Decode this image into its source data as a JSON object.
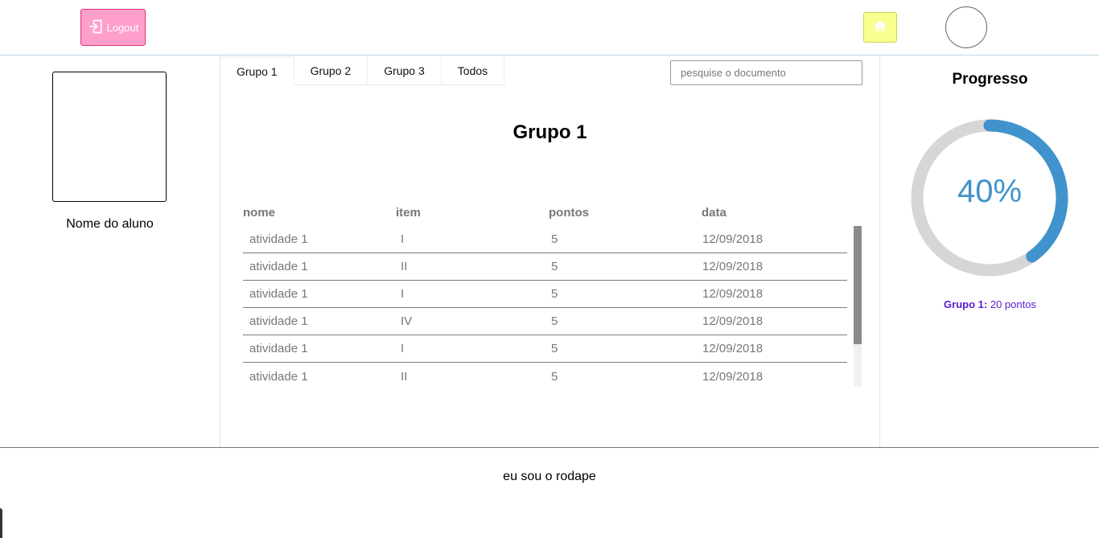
{
  "header": {
    "logout_label": "Logout"
  },
  "student": {
    "name": "Nome do aluno"
  },
  "tabs": [
    {
      "label": "Grupo 1",
      "active": true
    },
    {
      "label": "Grupo 2",
      "active": false
    },
    {
      "label": "Grupo 3",
      "active": false
    },
    {
      "label": "Todos",
      "active": false
    }
  ],
  "search": {
    "placeholder": "pesquise o documento",
    "value": ""
  },
  "main": {
    "title": "Grupo 1"
  },
  "table": {
    "headers": [
      "nome",
      "item",
      "pontos",
      "data"
    ],
    "rows": [
      [
        "atividade 1",
        "I",
        "5",
        "12/09/2018"
      ],
      [
        "atividade 1",
        "II",
        "5",
        "12/09/2018"
      ],
      [
        "atividade 1",
        "I",
        "5",
        "12/09/2018"
      ],
      [
        "atividade 1",
        "IV",
        "5",
        "12/09/2018"
      ],
      [
        "atividade 1",
        "I",
        "5",
        "12/09/2018"
      ],
      [
        "atividade 1",
        "II",
        "5",
        "12/09/2018"
      ]
    ]
  },
  "progress": {
    "title": "Progresso",
    "percent": 40,
    "percent_label": "40%",
    "group_label": "Grupo 1:",
    "points_label": "20 pontos",
    "accent_color": "#4093cc",
    "track_color": "#d6d6d6"
  },
  "footer": {
    "text": "eu sou o rodape"
  },
  "colors": {
    "logout_bg": "#ff9fcc",
    "home_bg": "#f7ff8e",
    "points_text": "#5a1ad0"
  },
  "icons": {
    "logout": "logout-icon",
    "home": "home-icon"
  }
}
